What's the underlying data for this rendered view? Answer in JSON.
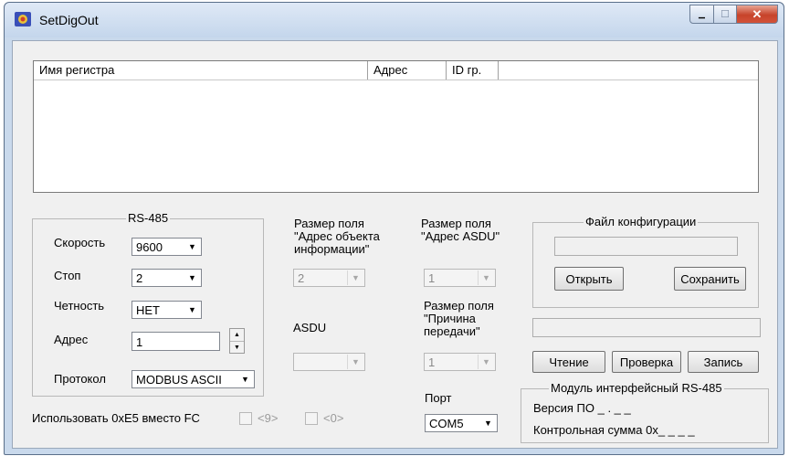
{
  "window": {
    "title": "SetDigOut",
    "close_glyph": "✕"
  },
  "list": {
    "columns": [
      "Имя регистра",
      "Адрес",
      "ID гр."
    ]
  },
  "rs485": {
    "title": "RS-485",
    "speed_label": "Скорость",
    "speed_value": "9600",
    "stop_label": "Стоп",
    "stop_value": "2",
    "parity_label": "Четность",
    "parity_value": "НЕТ",
    "address_label": "Адрес",
    "address_value": "1",
    "protocol_label": "Протокол",
    "protocol_value": "MODBUS ASCII"
  },
  "ioa_size": {
    "label_line1": "Размер поля",
    "label_line2": "\"Адрес объекта",
    "label_line3": "информации\"",
    "value": "2"
  },
  "asdu": {
    "label": "ASDU",
    "value": ""
  },
  "asdu_addr_size": {
    "label_line1": "Размер поля",
    "label_line2": "\"Адрес ASDU\"",
    "value": "1"
  },
  "cause_size": {
    "label_line1": "Размер поля",
    "label_line2": "\"Причина",
    "label_line3": "передачи\"",
    "value": "1"
  },
  "port": {
    "label": "Порт",
    "value": "COM5"
  },
  "use_e5": {
    "label": "Использовать 0xE5 вместо FC",
    "opt1": "<9>",
    "opt2": "<0>"
  },
  "config_file": {
    "title": "Файл конфигурации",
    "path_value": "",
    "open_label": "Открыть",
    "save_label": "Сохранить"
  },
  "actions": {
    "read_label": "Чтение",
    "check_label": "Проверка",
    "write_label": "Запись"
  },
  "status_value": "",
  "module": {
    "title": "Модуль интерфейсный RS-485",
    "version_label": "Версия ПО _ . _ _",
    "checksum_label": "Контрольная сумма 0x_ _ _ _"
  },
  "icons": {
    "dropdown": "▼",
    "spin_up": "▲",
    "spin_down": "▼",
    "minimize": "▁",
    "maximize": "☐"
  }
}
